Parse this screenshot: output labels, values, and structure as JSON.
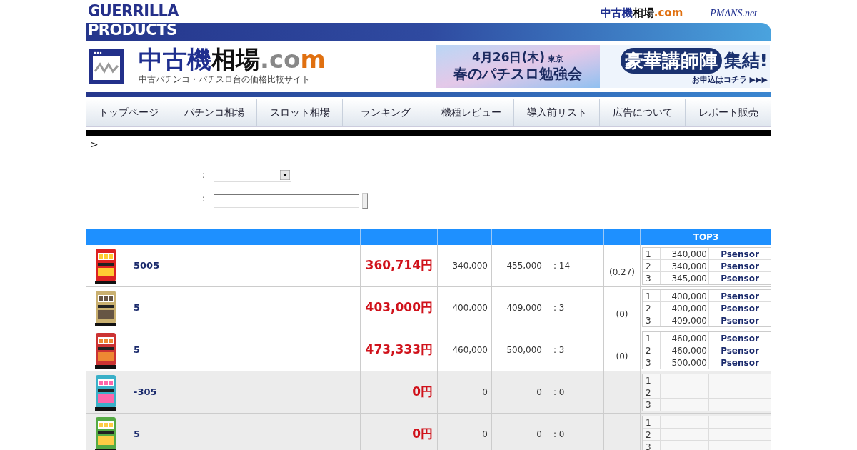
{
  "brand": {
    "line1": "GUERRILLA",
    "line2": "PRODUCTS"
  },
  "top_links": {
    "site_parts": [
      {
        "text": "中古機",
        "color": "#1f2f8f"
      },
      {
        "text": "相場",
        "color": "#111111"
      },
      {
        "text": ".com",
        "color": "#e07010"
      }
    ],
    "partner": "PMANS.net"
  },
  "site_logo": {
    "parts": [
      {
        "text": "中古機",
        "color": "#1f2f8f"
      },
      {
        "text": "相場",
        "color": "#111111"
      },
      {
        "text": ".co",
        "color": "#888888"
      },
      {
        "text": "m",
        "color": "#e07010"
      }
    ],
    "tagline": "中古パチンコ・パチスロ台の価格比較サイト"
  },
  "banner": {
    "date": "4月26日(木)",
    "place": "東京",
    "event": "春のパチスロ勉強会",
    "headline": "豪華講師陣",
    "headline_suffix": "集結!",
    "cta": "お申込はコチラ ▶▶▶"
  },
  "nav": [
    "トップページ",
    "パチンコ相場",
    "スロット相場",
    "ランキング",
    "機種レビュー",
    "導入前リスト",
    "広告について",
    "レポート販売"
  ],
  "breadcrumb": ">",
  "form": [
    {
      "label": ":",
      "kind": "select"
    },
    {
      "label": ":",
      "kind": "text"
    }
  ],
  "table": {
    "top3_heading": "TOP3",
    "rows": [
      {
        "name": "5005",
        "price": "360,714円",
        "min": "340,000",
        "max": "455,000",
        "count": ": 14",
        "ratio": "(0.27)",
        "shaded": false,
        "top3": [
          {
            "rank": "1",
            "price": "340,000",
            "shop": "Psensor"
          },
          {
            "rank": "2",
            "price": "340,000",
            "shop": "Psensor"
          },
          {
            "rank": "3",
            "price": "345,000",
            "shop": "Psensor"
          }
        ]
      },
      {
        "name": "5",
        "price": "403,000円",
        "min": "400,000",
        "max": "409,000",
        "count": ": 3",
        "ratio": "(0)",
        "shaded": false,
        "top3": [
          {
            "rank": "1",
            "price": "400,000",
            "shop": "Psensor"
          },
          {
            "rank": "2",
            "price": "400,000",
            "shop": "Psensor"
          },
          {
            "rank": "3",
            "price": "409,000",
            "shop": "Psensor"
          }
        ]
      },
      {
        "name": "5",
        "price": "473,333円",
        "min": "460,000",
        "max": "500,000",
        "count": ": 3",
        "ratio": "(0)",
        "shaded": false,
        "top3": [
          {
            "rank": "1",
            "price": "460,000",
            "shop": "Psensor"
          },
          {
            "rank": "2",
            "price": "460,000",
            "shop": "Psensor"
          },
          {
            "rank": "3",
            "price": "500,000",
            "shop": "Psensor"
          }
        ]
      },
      {
        "name": "-305",
        "price": "0円",
        "min": "0",
        "max": "0",
        "count": ": 0",
        "shaded": true,
        "top3": [
          {
            "rank": "1"
          },
          {
            "rank": "2"
          },
          {
            "rank": "3"
          }
        ]
      },
      {
        "name": "5",
        "price": "0円",
        "min": "0",
        "max": "0",
        "count": ": 0",
        "shaded": true,
        "top3": [
          {
            "rank": "1"
          },
          {
            "rank": "2"
          },
          {
            "rank": "3"
          }
        ]
      }
    ]
  }
}
